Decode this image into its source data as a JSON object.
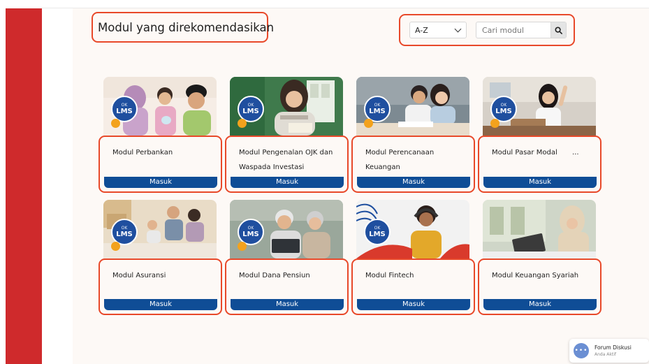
{
  "header": {
    "title": "Modul yang direkomendasikan"
  },
  "sort": {
    "value": "A-Z"
  },
  "search": {
    "placeholder": "Cari modul"
  },
  "icons": {
    "search": "search-icon",
    "chevron": "chevron-down-icon",
    "chat": "chat-bubble-icon"
  },
  "colors": {
    "sidebar": "#cf2a2c",
    "highlight": "#e8492a",
    "button": "#0f4d96",
    "badge": "#1f4f9f",
    "dot": "#f3a21d"
  },
  "badge": {
    "brand": "OK",
    "label": "LMS"
  },
  "modules": [
    {
      "title": "Modul Perbankan",
      "button": "Masuk"
    },
    {
      "title": "Modul Pengenalan OJK dan Waspada Investasi",
      "button": "Masuk"
    },
    {
      "title": "Modul Perencanaan Keuangan",
      "button": "Masuk"
    },
    {
      "title": "Modul Pasar Modal",
      "extra": "...",
      "button": "Masuk"
    },
    {
      "title": "Modul Asuransi",
      "button": "Masuk"
    },
    {
      "title": "Modul Dana Pensiun",
      "button": "Masuk"
    },
    {
      "title": "Modul Fintech",
      "button": "Masuk"
    },
    {
      "title": "Modul Keuangan Syariah",
      "button": "Masuk"
    }
  ],
  "forum": {
    "title": "Forum Diskusi",
    "status": "Anda Aktif"
  }
}
